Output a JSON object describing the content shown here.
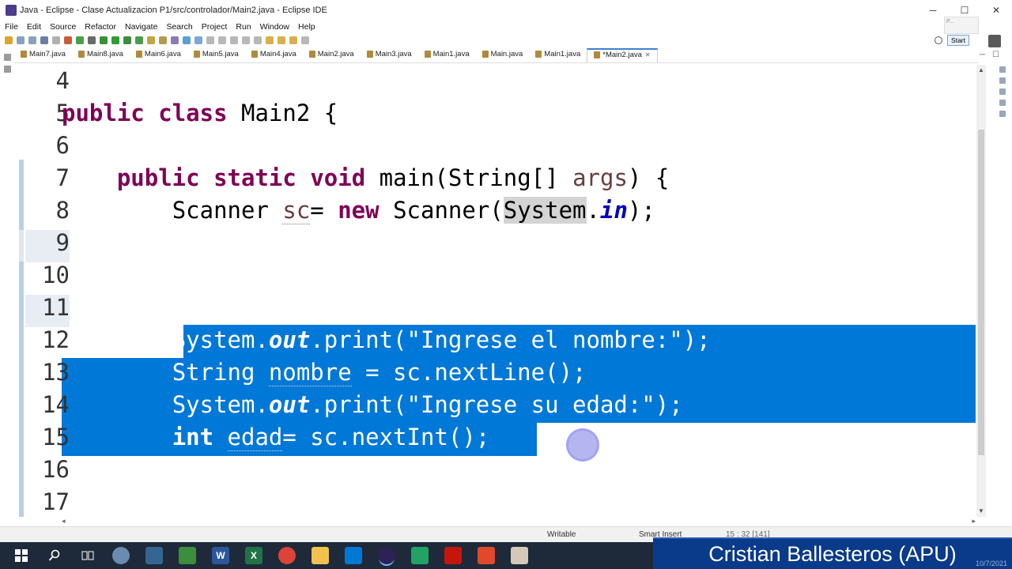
{
  "window": {
    "title": "Java - Eclipse - Clase Actualizacion P1/src/controlador/Main2.java - Eclipse IDE",
    "minimize": "─",
    "maximize": "☐",
    "close": "✕"
  },
  "menu": [
    "File",
    "Edit",
    "Source",
    "Refactor",
    "Navigate",
    "Search",
    "Project",
    "Run",
    "Window",
    "Help"
  ],
  "toolbar": {
    "quick_access_label": "P...",
    "start_button": "Start"
  },
  "tabs": [
    {
      "label": "Main7.java",
      "active": false
    },
    {
      "label": "Main8.java",
      "active": false
    },
    {
      "label": "Main6.java",
      "active": false
    },
    {
      "label": "Main5.java",
      "active": false
    },
    {
      "label": "Main4.java",
      "active": false
    },
    {
      "label": "Main2.java",
      "active": false
    },
    {
      "label": "Main3.java",
      "active": false
    },
    {
      "label": "Main1.java",
      "active": false
    },
    {
      "label": "Main.java",
      "active": false
    },
    {
      "label": "Main1.java",
      "active": false
    },
    {
      "label": "*Main2.java",
      "active": true
    }
  ],
  "tab_close": "✕",
  "tab_controls": {
    "minimize": "─",
    "maximize": "☐"
  },
  "editor": {
    "line_numbers": [
      "4",
      "5",
      "6",
      "7",
      "8",
      "9",
      "10",
      "11",
      "12",
      "13",
      "14",
      "15",
      "16",
      "17"
    ],
    "lines": {
      "l5": {
        "kw1": "public",
        "kw2": "class",
        "rest": " Main2 {"
      },
      "l7": {
        "kw1": "public",
        "kw2": "static",
        "kw3": "void",
        "rest": " main(String[] ",
        "param": "args",
        "end": ") {"
      },
      "l8": {
        "a": "Scanner ",
        "var": "sc",
        "b": "= ",
        "kw": "new",
        "c": " Scanner(",
        "sys": "System",
        "d": ".",
        "field": "in",
        "e": ");"
      },
      "l12": {
        "a": "System.",
        "field": "out",
        "b": ".print(\"Ingrese el nombre:\");"
      },
      "l13": {
        "a": "String ",
        "var": "nombre",
        "b": " = sc.nextLine();"
      },
      "l14": {
        "a": "System.",
        "field": "out",
        "b": ".print(\"Ingrese su edad:\");"
      },
      "l15": {
        "kw": "int",
        "a": " ",
        "var": "edad",
        "b": "= sc.nextInt();"
      }
    }
  },
  "status": {
    "writable": "Writable",
    "insert_mode": "Smart Insert",
    "position": "15 : 32 [141]"
  },
  "watermark": {
    "name": "Cristian Ballesteros (APU)",
    "date": "10/7/2021"
  },
  "taskbar": {
    "icons": [
      "windows-icon",
      "search-icon",
      "task-view-icon",
      "app-icon",
      "pgadmin-icon",
      "notepad-icon",
      "word-icon",
      "excel-icon",
      "chrome-icon",
      "explorer-icon",
      "vscode-icon",
      "eclipse-icon",
      "green-app-icon",
      "acrobat-icon",
      "red-app-icon",
      "paint-icon"
    ]
  }
}
